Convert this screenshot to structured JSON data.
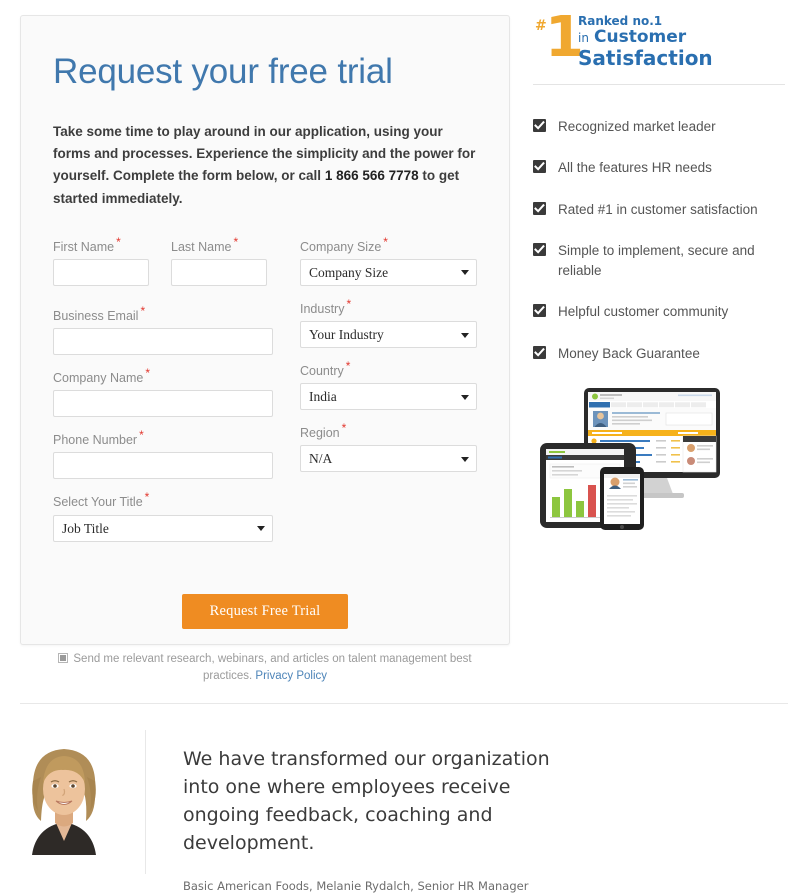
{
  "form": {
    "headline": "Request your free trial",
    "intro_before": "Take some time to play around in our application, using your forms and processes. Experience the simplicity and the power for yourself. Complete the form below, or call ",
    "intro_phone": "1 866 566 7778",
    "intro_after": " to get started immediately.",
    "required_mark": "*",
    "fields": {
      "first_name": {
        "label": "First Name",
        "value": "",
        "placeholder": ""
      },
      "last_name": {
        "label": "Last Name",
        "value": "",
        "placeholder": ""
      },
      "business_email": {
        "label": "Business Email",
        "value": "",
        "placeholder": ""
      },
      "company_name": {
        "label": "Company Name",
        "value": "",
        "placeholder": ""
      },
      "phone_number": {
        "label": "Phone Number",
        "value": "",
        "placeholder": ""
      },
      "job_title": {
        "label": "Select Your Title",
        "value": "Job Title"
      },
      "company_size": {
        "label": "Company Size",
        "value": "Company Size"
      },
      "industry": {
        "label": "Industry",
        "value": "Your Industry"
      },
      "country": {
        "label": "Country",
        "value": "India"
      },
      "region": {
        "label": "Region",
        "value": "N/A"
      }
    },
    "submit_label": "Request Free Trial",
    "consent_text": "Send me relevant research, webinars, and articles on talent management best practices.",
    "consent_checked": true,
    "privacy_link": "Privacy Policy",
    "accent_button_color": "#ef8c22",
    "headline_color": "#4078ad",
    "required_color": "#e2372e"
  },
  "badge": {
    "hash": "#",
    "numeral": "1",
    "line1": "Ranked no.1",
    "line2_small": "in",
    "line2_large": "Customer",
    "line3": "Satisfaction",
    "gold_color": "#f0a830",
    "blue_color": "#2a6fb0"
  },
  "benefits": [
    {
      "label": "Recognized market leader"
    },
    {
      "label": "All the features HR needs"
    },
    {
      "label": "Rated #1 in customer satisfaction"
    },
    {
      "label": "Simple to implement, secure and reliable"
    },
    {
      "label": "Helpful customer community"
    },
    {
      "label": "Money Back Guarantee"
    }
  ],
  "devices": {
    "caption": "product-screens-desktop-tablet-phone"
  },
  "testimonial": {
    "quote": "We have transformed our organization into one where employees receive ongoing feedback, coaching and development.",
    "attribution": "Basic American Foods, Melanie Rydalch, Senior HR Manager"
  }
}
